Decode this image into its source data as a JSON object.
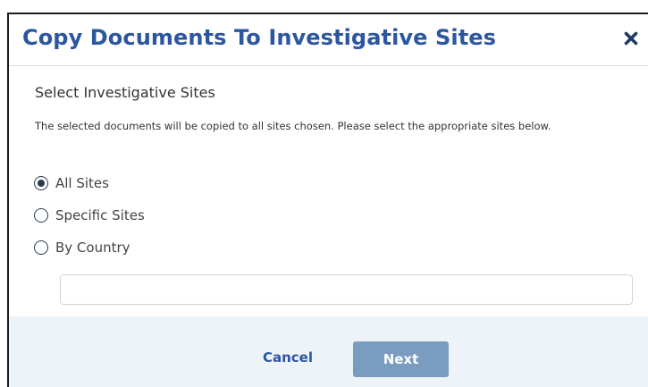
{
  "dialog": {
    "title": "Copy Documents To Investigative Sites",
    "close_icon": "close-icon"
  },
  "body": {
    "heading": "Select Investigative Sites",
    "description": "The selected documents will be copied to all sites chosen. Please select the appropriate sites below.",
    "options": [
      {
        "label": "All Sites",
        "checked": true
      },
      {
        "label": "Specific Sites",
        "checked": false
      },
      {
        "label": "By Country",
        "checked": false
      }
    ],
    "site_input": {
      "value": "",
      "placeholder": ""
    }
  },
  "footer": {
    "cancel_label": "Cancel",
    "next_label": "Next"
  },
  "colors": {
    "title": "#2b56a0",
    "footer_background": "#eef3f8",
    "next_button": "#7a9cc0"
  }
}
